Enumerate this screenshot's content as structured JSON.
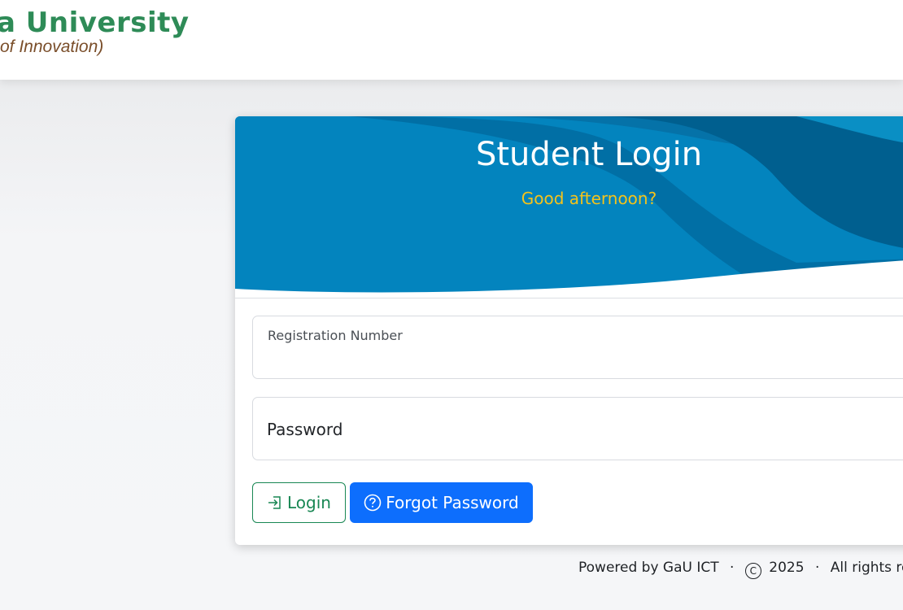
{
  "header": {
    "brand_name": "a University",
    "tagline": "of Innovation)"
  },
  "login_card": {
    "title": "Student Login",
    "greeting": "Good afternoon?",
    "registration_label": "Registration Number",
    "password_label": "Password",
    "login_button": "Login",
    "forgot_button": "Forgot Password"
  },
  "footer": {
    "powered_by": "Powered by GaU ICT",
    "year": "2025",
    "rights": "All rights rese"
  },
  "colors": {
    "brand_green": "#2e8b57",
    "tagline_brown": "#7a4e2a",
    "header_blue": "#0384be",
    "header_dark_blue": "#005f8f",
    "greeting_yellow": "#f5c31a",
    "login_green": "#198754",
    "primary_blue": "#0d6efd"
  },
  "icons": {
    "login": "box-arrow-in-right-icon",
    "forgot": "question-circle-icon",
    "copyright": "copyright-icon"
  }
}
